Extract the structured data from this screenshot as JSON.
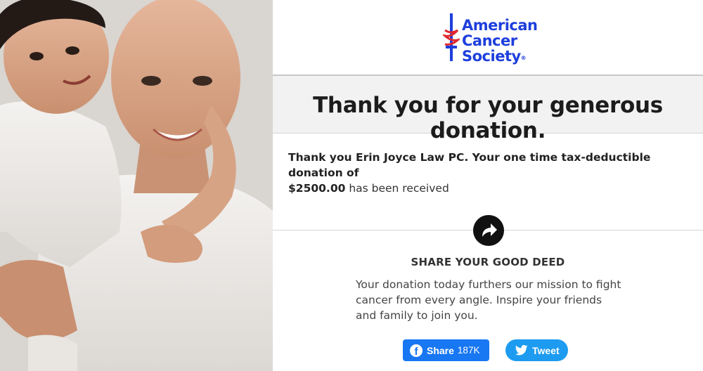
{
  "logo": {
    "line1": "American",
    "line2": "Cancer",
    "line3": "Society",
    "registered": "®",
    "color": "#1e3fdc",
    "sword_color": "#e0282e"
  },
  "header": {
    "title": "Thank you for your generous donation."
  },
  "message": {
    "bold_text": "Thank you Erin Joyce Law PC.  Your one time tax-deductible donation of",
    "amount": "$2500.00",
    "suffix": " has been received"
  },
  "share": {
    "icon": "share-arrow-icon",
    "title": "SHARE YOUR GOOD DEED",
    "description": "Your donation today furthers our mission to fight cancer from every angle. Inspire your friends and family to join you."
  },
  "buttons": {
    "facebook": {
      "label": "Share",
      "count": "187K",
      "icon": "facebook-icon",
      "color": "#1877f2"
    },
    "twitter": {
      "label": "Tweet",
      "icon": "twitter-bird-icon",
      "color": "#1d9bf0"
    }
  }
}
